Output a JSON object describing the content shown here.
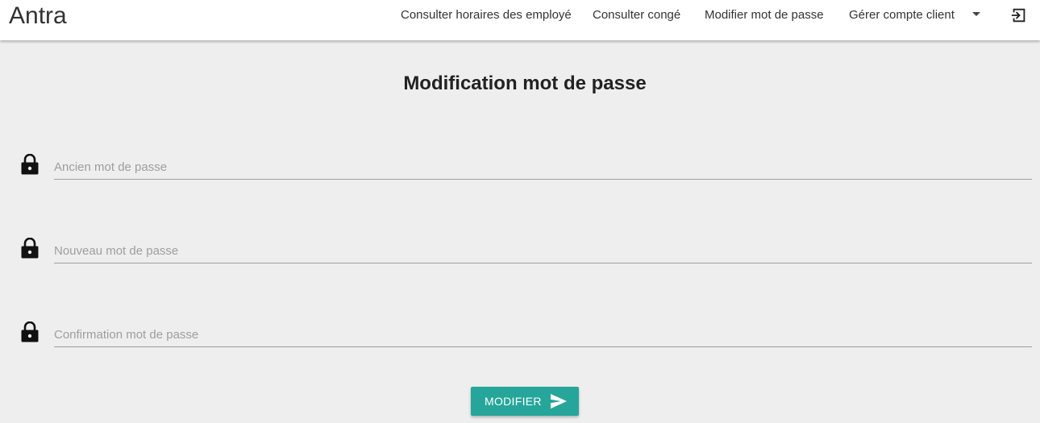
{
  "app": {
    "brand": "Antra"
  },
  "nav": {
    "items": [
      {
        "label": "Consulter horaires des employé"
      },
      {
        "label": "Consulter congé"
      },
      {
        "label": "Modifier mot de passe"
      },
      {
        "label": "Gérer compte client"
      }
    ],
    "dropdown_icon": "caret-down-icon",
    "logout_icon": "logout-icon"
  },
  "page": {
    "title": "Modification mot de passe"
  },
  "form": {
    "fields": [
      {
        "icon": "lock-icon",
        "placeholder": "Ancien mot de passe",
        "value": ""
      },
      {
        "icon": "lock-icon",
        "placeholder": "Nouveau mot de passe",
        "value": ""
      },
      {
        "icon": "lock-icon",
        "placeholder": "Confirmation mot de passe",
        "value": ""
      }
    ],
    "submit": {
      "label": "MODIFIER",
      "icon": "send-icon"
    }
  },
  "colors": {
    "accent": "#26a69a",
    "background": "#eeeeee",
    "navbar": "#ffffff"
  }
}
